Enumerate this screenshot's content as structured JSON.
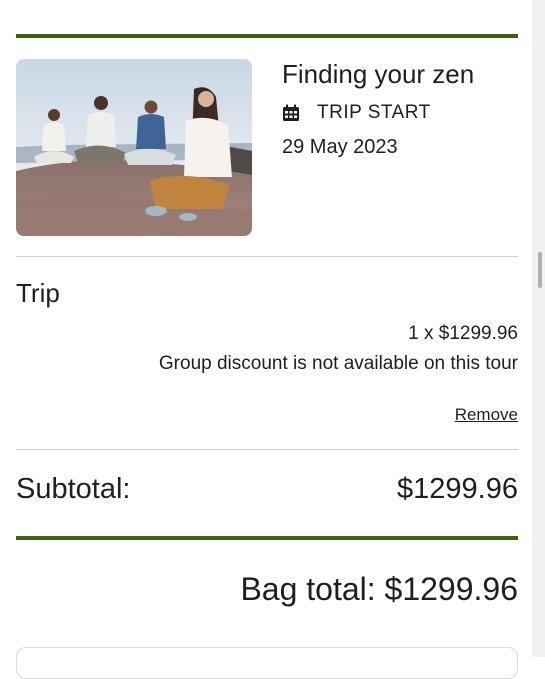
{
  "trip": {
    "title": "Finding your zen",
    "start_label": "TRIP START",
    "start_icon": "calendar-icon",
    "start_date": "29 May 2023",
    "image": "group-meditation-photo"
  },
  "line_item": {
    "section_label": "Trip",
    "quantity_price": "1 x $1299.96",
    "discount_note": "Group discount is not available on this tour",
    "remove_label": "Remove"
  },
  "summary": {
    "subtotal_label": "Subtotal:",
    "subtotal_value": "$1299.96",
    "bag_total": "Bag total: $1299.96"
  },
  "colors": {
    "accent_green": "#3f6212",
    "divider_grey": "#cfcfcf",
    "text": "#1f1f1f"
  }
}
